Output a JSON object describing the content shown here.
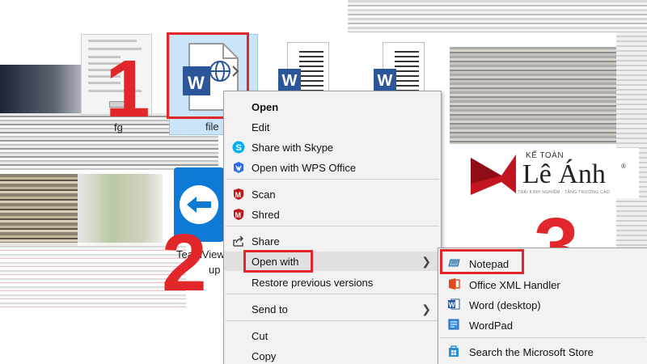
{
  "desktop": {
    "items": [
      {
        "label": "fg"
      },
      {
        "label": "file"
      },
      {
        "label": "TeamView"
      },
      {
        "label": "up"
      }
    ]
  },
  "steps": [
    "1",
    "2",
    "3"
  ],
  "context_menu": {
    "items": [
      {
        "label": "Open",
        "icon": "none",
        "bold": true
      },
      {
        "label": "Edit",
        "icon": "none"
      },
      {
        "label": "Share with Skype",
        "icon": "skype-icon"
      },
      {
        "label": "Open with WPS Office",
        "icon": "wps-icon"
      },
      {
        "label": "Scan",
        "icon": "mcafee-icon"
      },
      {
        "label": "Shred",
        "icon": "mcafee-icon"
      },
      {
        "label": "Share",
        "icon": "share-icon"
      },
      {
        "label": "Open with",
        "icon": "none",
        "submenu": true
      },
      {
        "label": "Restore previous versions",
        "icon": "none"
      },
      {
        "label": "Send to",
        "icon": "none",
        "submenu": true
      },
      {
        "label": "Cut",
        "icon": "none"
      },
      {
        "label": "Copy",
        "icon": "none"
      }
    ]
  },
  "open_with_submenu": {
    "items": [
      {
        "label": "Notepad",
        "icon": "notepad-icon"
      },
      {
        "label": "Office XML Handler",
        "icon": "office-icon"
      },
      {
        "label": "Word (desktop)",
        "icon": "word-icon"
      },
      {
        "label": "WordPad",
        "icon": "wordpad-icon"
      },
      {
        "label": "Search the Microsoft Store",
        "icon": "store-icon"
      }
    ]
  },
  "logo": {
    "small": "KẾ TOÁN",
    "big": "Lê Ánh",
    "reg": "®",
    "tagline": "TRẢI KINH NGHIỆM - TĂNG TRƯỞNG CAO"
  },
  "colors": {
    "accent_red": "#e1272a",
    "word_blue": "#2b579a",
    "teamviewer_blue": "#0e7ad5",
    "selection": "#cce4f7"
  }
}
